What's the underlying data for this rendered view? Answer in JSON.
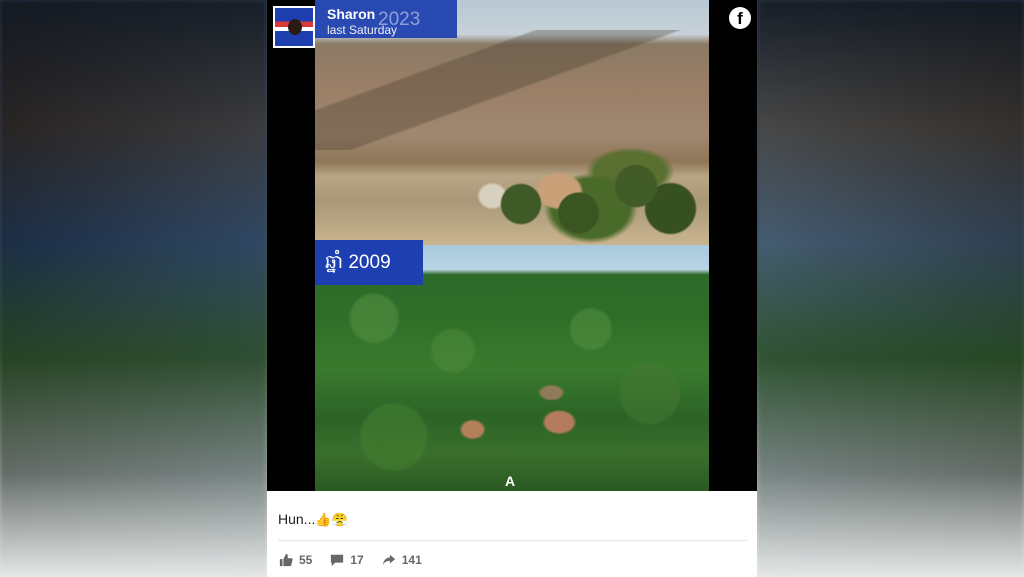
{
  "post": {
    "author": "Sharon",
    "time": "last Saturday",
    "caption_text": "Hun...",
    "caption_emoji": "👍😤",
    "platform_icon": "facebook-icon",
    "photo_top_label": "2023",
    "photo_bottom_label": "ឆ្នាំ 2009",
    "watermark": "A"
  },
  "stats": {
    "likes": "55",
    "comments": "17",
    "shares": "141"
  },
  "colors": {
    "label_bg": "#1d3fb0",
    "post_bg": "#ffffff",
    "media_bg": "#000000"
  }
}
